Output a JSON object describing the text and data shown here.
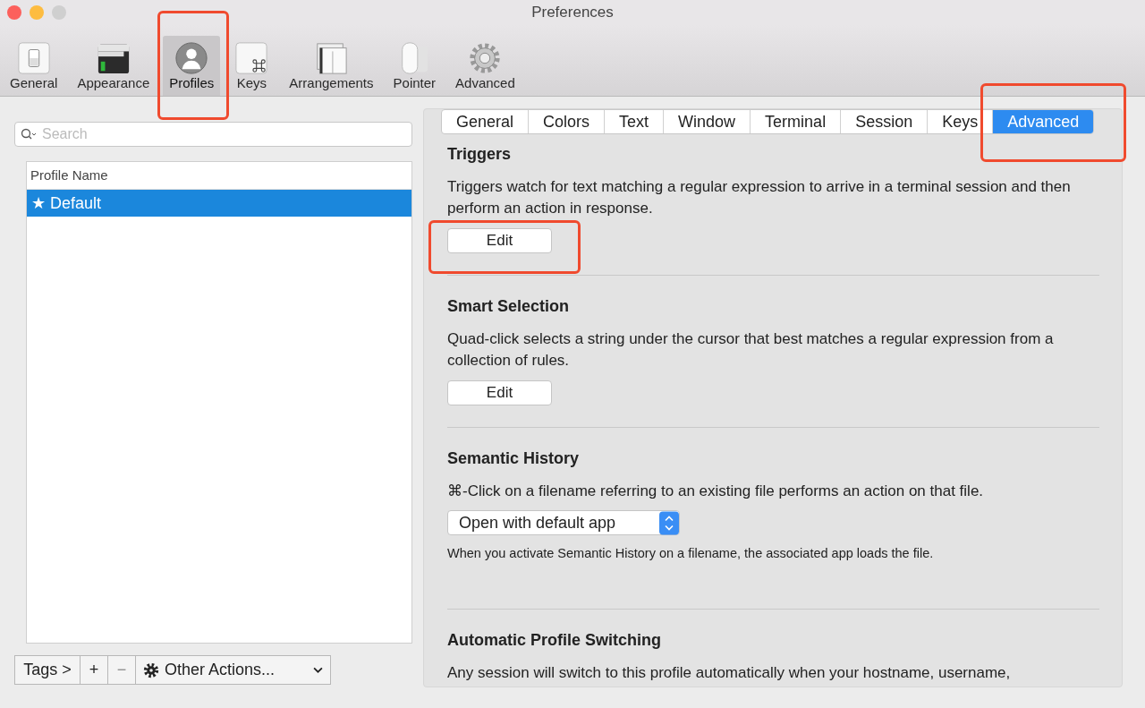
{
  "window": {
    "title": "Preferences"
  },
  "toolbar": [
    {
      "label": "General",
      "selected": false
    },
    {
      "label": "Appearance",
      "selected": false
    },
    {
      "label": "Profiles",
      "selected": true
    },
    {
      "label": "Keys",
      "selected": false
    },
    {
      "label": "Arrangements",
      "selected": false
    },
    {
      "label": "Pointer",
      "selected": false
    },
    {
      "label": "Advanced",
      "selected": false
    }
  ],
  "search": {
    "placeholder": "Search"
  },
  "profiles": {
    "column": "Profile Name",
    "rows": [
      {
        "label": "★ Default",
        "selected": true
      }
    ]
  },
  "bottom_bar": {
    "tags": "Tags >",
    "add": "+",
    "remove": "−",
    "actions": "Other Actions..."
  },
  "tabs": [
    {
      "label": "General",
      "selected": false
    },
    {
      "label": "Colors",
      "selected": false
    },
    {
      "label": "Text",
      "selected": false
    },
    {
      "label": "Window",
      "selected": false
    },
    {
      "label": "Terminal",
      "selected": false
    },
    {
      "label": "Session",
      "selected": false
    },
    {
      "label": "Keys",
      "selected": false
    },
    {
      "label": "Advanced",
      "selected": true
    }
  ],
  "sections": [
    {
      "title": "Triggers",
      "description": "Triggers watch for text matching a regular expression to arrive in a terminal session and then perform an action in response.",
      "kind": "button",
      "control": "Edit"
    },
    {
      "title": "Smart Selection",
      "description": "Quad-click selects a string under the cursor that best matches a regular expression from a collection of rules.",
      "kind": "button",
      "control": "Edit"
    },
    {
      "title": "Semantic History",
      "description": "⌘-Click on a filename referring to an existing file performs an action on that file.",
      "kind": "popup",
      "control": "Open with default app",
      "note": "When you activate Semantic History on a filename, the associated app loads the file."
    },
    {
      "title": "Automatic Profile Switching",
      "description": "Any session will switch to this profile automatically when your hostname, username,",
      "kind": "text"
    }
  ]
}
